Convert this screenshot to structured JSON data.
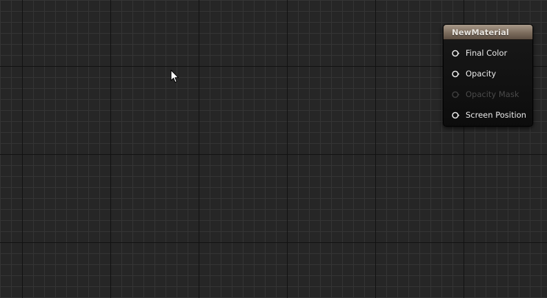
{
  "graph": {
    "node": {
      "title": "NewMaterial",
      "pins": [
        {
          "label": "Final Color",
          "enabled": true
        },
        {
          "label": "Opacity",
          "enabled": true
        },
        {
          "label": "Opacity Mask",
          "enabled": false
        },
        {
          "label": "Screen Position",
          "enabled": true
        }
      ]
    },
    "colors": {
      "background": "#262626",
      "grid_minor": "#353535",
      "grid_major": "#111111",
      "node_header": "#8a7b6c",
      "pin_enabled": "#e6e6e6",
      "pin_disabled": "#3c3c3c"
    },
    "icons": {
      "pin": "pin-connector-icon",
      "cursor": "mouse-cursor-icon"
    }
  }
}
